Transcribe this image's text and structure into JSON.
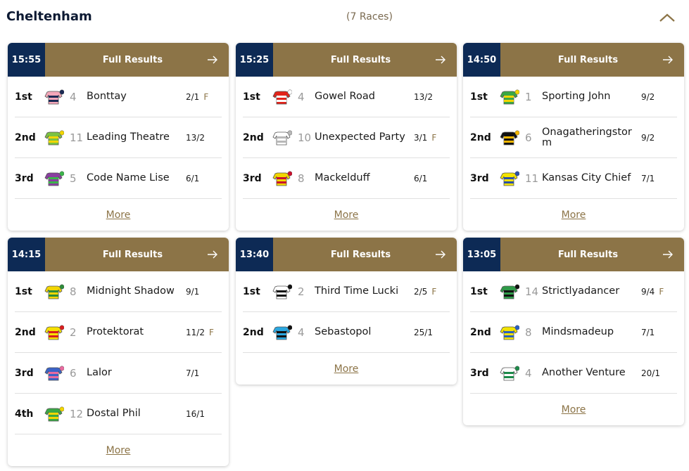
{
  "meeting": {
    "title": "Cheltenham",
    "race_count": "(7 Races)"
  },
  "colors": {
    "navy": "#0d2a55",
    "gold": "#8c7447"
  },
  "races": [
    {
      "time": "15:55",
      "results_label": "Full Results",
      "more_label": "More",
      "runners": [
        {
          "pos": "1st",
          "num": "4",
          "horse": "Bonttay",
          "odds": "2/1",
          "fav": "F",
          "silk": "pink-navy"
        },
        {
          "pos": "2nd",
          "num": "11",
          "horse": "Leading Theatre",
          "odds": "13/2",
          "fav": "",
          "silk": "green-yellow-check"
        },
        {
          "pos": "3rd",
          "num": "5",
          "horse": "Code Name Lise",
          "odds": "6/1",
          "fav": "",
          "silk": "purple-green-spots"
        }
      ]
    },
    {
      "time": "15:25",
      "results_label": "Full Results",
      "more_label": "More",
      "runners": [
        {
          "pos": "1st",
          "num": "4",
          "horse": "Gowel Road",
          "odds": "13/2",
          "fav": "",
          "silk": "red-white-hoop"
        },
        {
          "pos": "2nd",
          "num": "10",
          "horse": "Unexpected Party",
          "odds": "3/1",
          "fav": "F",
          "silk": "white-grey"
        },
        {
          "pos": "3rd",
          "num": "8",
          "horse": "Mackelduff",
          "odds": "6/1",
          "fav": "",
          "silk": "red-yellow-m"
        }
      ]
    },
    {
      "time": "14:50",
      "results_label": "Full Results",
      "more_label": "More",
      "runners": [
        {
          "pos": "1st",
          "num": "1",
          "horse": "Sporting John",
          "odds": "9/2",
          "fav": "",
          "silk": "green-yellow-hoops"
        },
        {
          "pos": "2nd",
          "num": "6",
          "horse": "Onagatheringstorm",
          "odds": "9/2",
          "fav": "",
          "silk": "black-gold-star"
        },
        {
          "pos": "3rd",
          "num": "11",
          "horse": "Kansas City Chief",
          "odds": "7/1",
          "fav": "",
          "silk": "yellow-blue-cross"
        }
      ]
    },
    {
      "time": "14:15",
      "results_label": "Full Results",
      "more_label": "More",
      "runners": [
        {
          "pos": "1st",
          "num": "8",
          "horse": "Midnight Shadow",
          "odds": "9/1",
          "fav": "",
          "silk": "yellow-green-stripes"
        },
        {
          "pos": "2nd",
          "num": "2",
          "horse": "Protektorat",
          "odds": "11/2",
          "fav": "F",
          "silk": "yellow-red-star"
        },
        {
          "pos": "3rd",
          "num": "6",
          "horse": "Lalor",
          "odds": "7/1",
          "fav": "",
          "silk": "blue-pink-hoops"
        },
        {
          "pos": "4th",
          "num": "12",
          "horse": "Dostal Phil",
          "odds": "16/1",
          "fav": "",
          "silk": "green-yellow-hoops"
        }
      ]
    },
    {
      "time": "13:40",
      "results_label": "Full Results",
      "more_label": "More",
      "runners": [
        {
          "pos": "1st",
          "num": "2",
          "horse": "Third Time Lucki",
          "odds": "2/5",
          "fav": "F",
          "silk": "white-black-diamond"
        },
        {
          "pos": "2nd",
          "num": "4",
          "horse": "Sebastopol",
          "odds": "25/1",
          "fav": "",
          "silk": "blue-black-star"
        }
      ]
    },
    {
      "time": "13:05",
      "results_label": "Full Results",
      "more_label": "More",
      "runners": [
        {
          "pos": "1st",
          "num": "14",
          "horse": "Strictlyadancer",
          "odds": "9/4",
          "fav": "F",
          "silk": "green-black"
        },
        {
          "pos": "2nd",
          "num": "8",
          "horse": "Mindsmadeup",
          "odds": "7/1",
          "fav": "",
          "silk": "blue-yellow-cross"
        },
        {
          "pos": "3rd",
          "num": "4",
          "horse": "Another Venture",
          "odds": "20/1",
          "fav": "",
          "silk": "white-green-stripe"
        }
      ]
    }
  ]
}
